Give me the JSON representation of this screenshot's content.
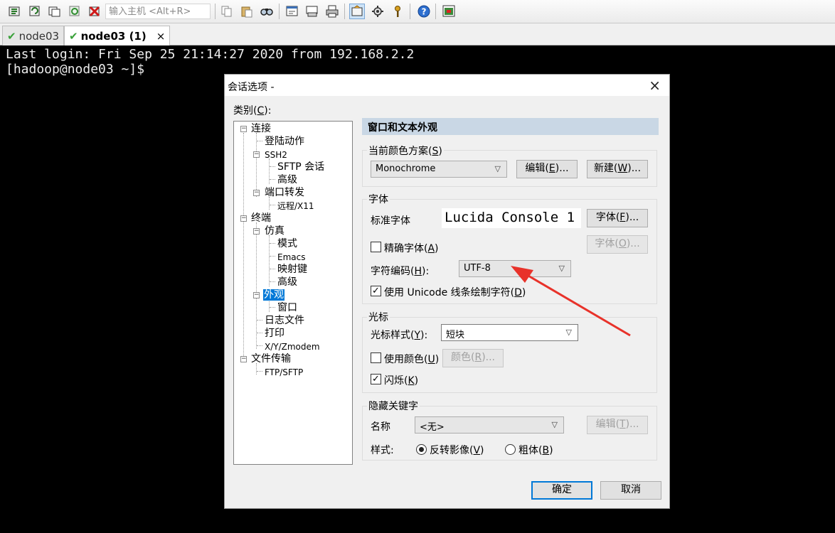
{
  "toolbar": {
    "host_placeholder": "输入主机 <Alt+R>",
    "icons": [
      "new-session-icon",
      "reconnect-icon",
      "clone-session-icon",
      "reconnect-all-icon",
      "disconnect-icon",
      "copy-icon",
      "paste-icon",
      "find-icon",
      "print-setup-icon",
      "print-preview-icon",
      "print-icon",
      "session-options-icon",
      "global-options-icon",
      "key-icon",
      "help-icon",
      "screen-icon"
    ]
  },
  "tabs": [
    {
      "label": "node03",
      "active": false
    },
    {
      "label": "node03 (1)",
      "active": true,
      "close": "×"
    }
  ],
  "terminal": {
    "lines": [
      "Last login: Fri Sep 25 21:14:27 2020 from 192.168.2.2",
      "[hadoop@node03 ~]$"
    ]
  },
  "dialog": {
    "title": "会话选项 -",
    "close": "×",
    "category_label": "类别(",
    "category_key": "C",
    "category_end": "):",
    "tree": {
      "connection": "连接",
      "login_actions": "登陆动作",
      "ssh2": "SSH2",
      "sftp_session": "SFTP 会话",
      "advanced1": "高级",
      "port_forwarding": "端口转发",
      "remote_x11": "远程/X11",
      "terminal": "终端",
      "emulation": "仿真",
      "modes": "模式",
      "emacs": "Emacs",
      "mapped_keys": "映射键",
      "advanced2": "高级",
      "appearance": "外观",
      "window": "窗口",
      "log_file": "日志文件",
      "printing": "打印",
      "xyzmodem": "X/Y/Zmodem",
      "file_transfer": "文件传输",
      "ftp_sftp": "FTP/SFTP"
    },
    "panel_title": "窗口和文本外观",
    "color_scheme": {
      "label": "当前颜色方案(",
      "key": "S",
      "end": ")",
      "value": "Monochrome",
      "edit_button": "编辑(",
      "edit_key": "E",
      "edit_end": ")...",
      "new_button": "新建(",
      "new_key": "W",
      "new_end": ")..."
    },
    "font": {
      "group_label": "字体",
      "standard_label": "标准字体",
      "preview": "Lucida Console 1",
      "font_button": "字体(",
      "font_key": "F",
      "font_end": ")...",
      "font_button2": "字体(",
      "font_key2": "O",
      "font_end2": ")...",
      "precise_label": "精确字体(",
      "precise_key": "A",
      "precise_end": ")",
      "encoding_label": "字符编码(",
      "encoding_key": "H",
      "encoding_end": "):",
      "encoding_value": "UTF-8",
      "unicode_label": "使用 Unicode 线条绘制字符(",
      "unicode_key": "D",
      "unicode_end": ")"
    },
    "cursor": {
      "group_label": "光标",
      "style_label": "光标样式(",
      "style_key": "Y",
      "style_end": "):",
      "style_value": "短块",
      "use_color_label": "使用颜色(",
      "use_color_key": "U",
      "use_color_end": ")",
      "color_button": "颜色(",
      "color_key": "R",
      "color_end": ")...",
      "blink_label": "闪烁(",
      "blink_key": "K",
      "blink_end": ")"
    },
    "hidden_keywords": {
      "group_label": "隐藏关键字",
      "name_label": "名称",
      "name_value": "<无>",
      "edit_button": "编辑(",
      "edit_key": "T",
      "edit_end": ")...",
      "style_label": "样式:",
      "reverse_label": "反转影像(",
      "reverse_key": "V",
      "reverse_end": ")",
      "bold_label": "粗体(",
      "bold_key": "B",
      "bold_end": ")"
    },
    "ok_button": "确定",
    "cancel_button": "取消"
  },
  "colors": {
    "selection": "#0078d7",
    "annotation_arrow": "#e8322a",
    "panel_header": "#c9d7e5"
  }
}
